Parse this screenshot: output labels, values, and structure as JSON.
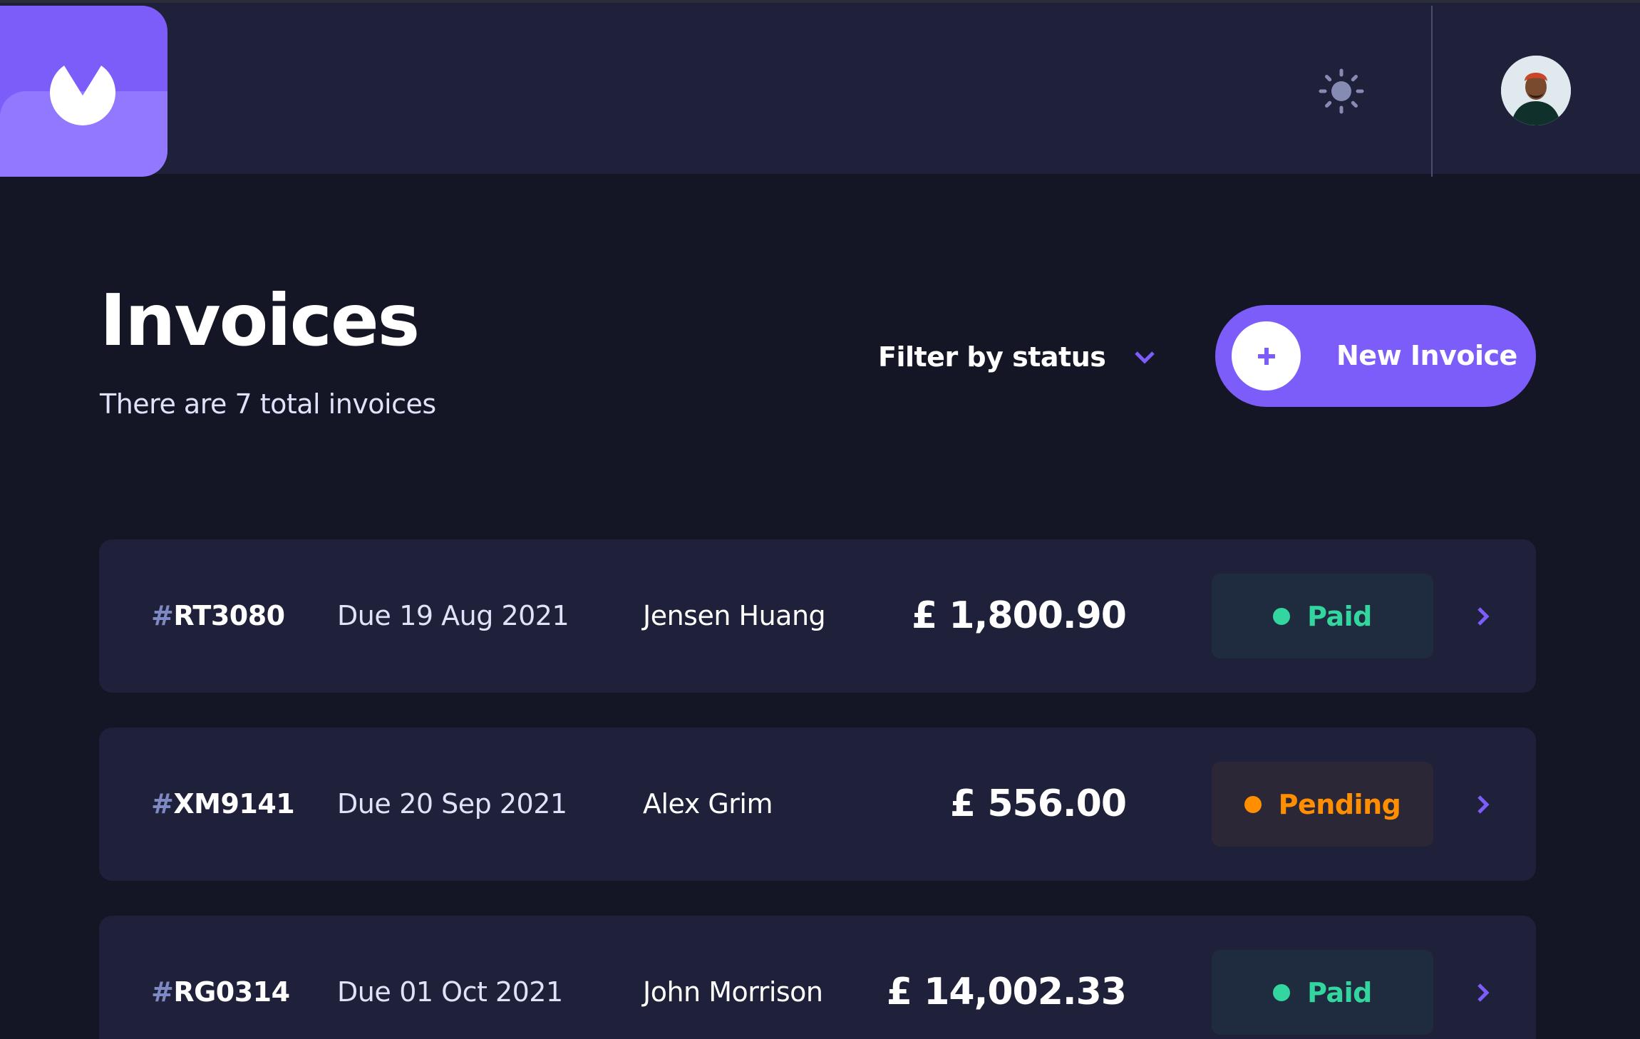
{
  "header": {
    "avatar_alt": "User avatar"
  },
  "main": {
    "title": "Invoices",
    "subtitle": "There are 7 total invoices",
    "filter_label": "Filter by status",
    "new_invoice_label": "New Invoice"
  },
  "invoices": [
    {
      "hash": "#",
      "id": "RT3080",
      "due_word": "Due",
      "due_date": "19 Aug 2021",
      "client": "Jensen Huang",
      "amount": "£ 1,800.90",
      "status": "Paid"
    },
    {
      "hash": "#",
      "id": "XM9141",
      "due_word": "Due",
      "due_date": "20 Sep 2021",
      "client": "Alex Grim",
      "amount": "£ 556.00",
      "status": "Pending"
    },
    {
      "hash": "#",
      "id": "RG0314",
      "due_word": "Due",
      "due_date": "01 Oct 2021",
      "client": "John Morrison",
      "amount": "£ 14,002.33",
      "status": "Paid"
    }
  ],
  "colors": {
    "accent": "#7c5dfa",
    "paid": "#33d69f",
    "pending": "#ff8f00",
    "background": "#141625",
    "surface": "#1e2139"
  },
  "icons": {
    "logo": "logo-icon",
    "theme_toggle": "sun-icon",
    "filter": "chevron-down-icon",
    "new_invoice": "plus-icon",
    "row_action": "chevron-right-icon"
  }
}
